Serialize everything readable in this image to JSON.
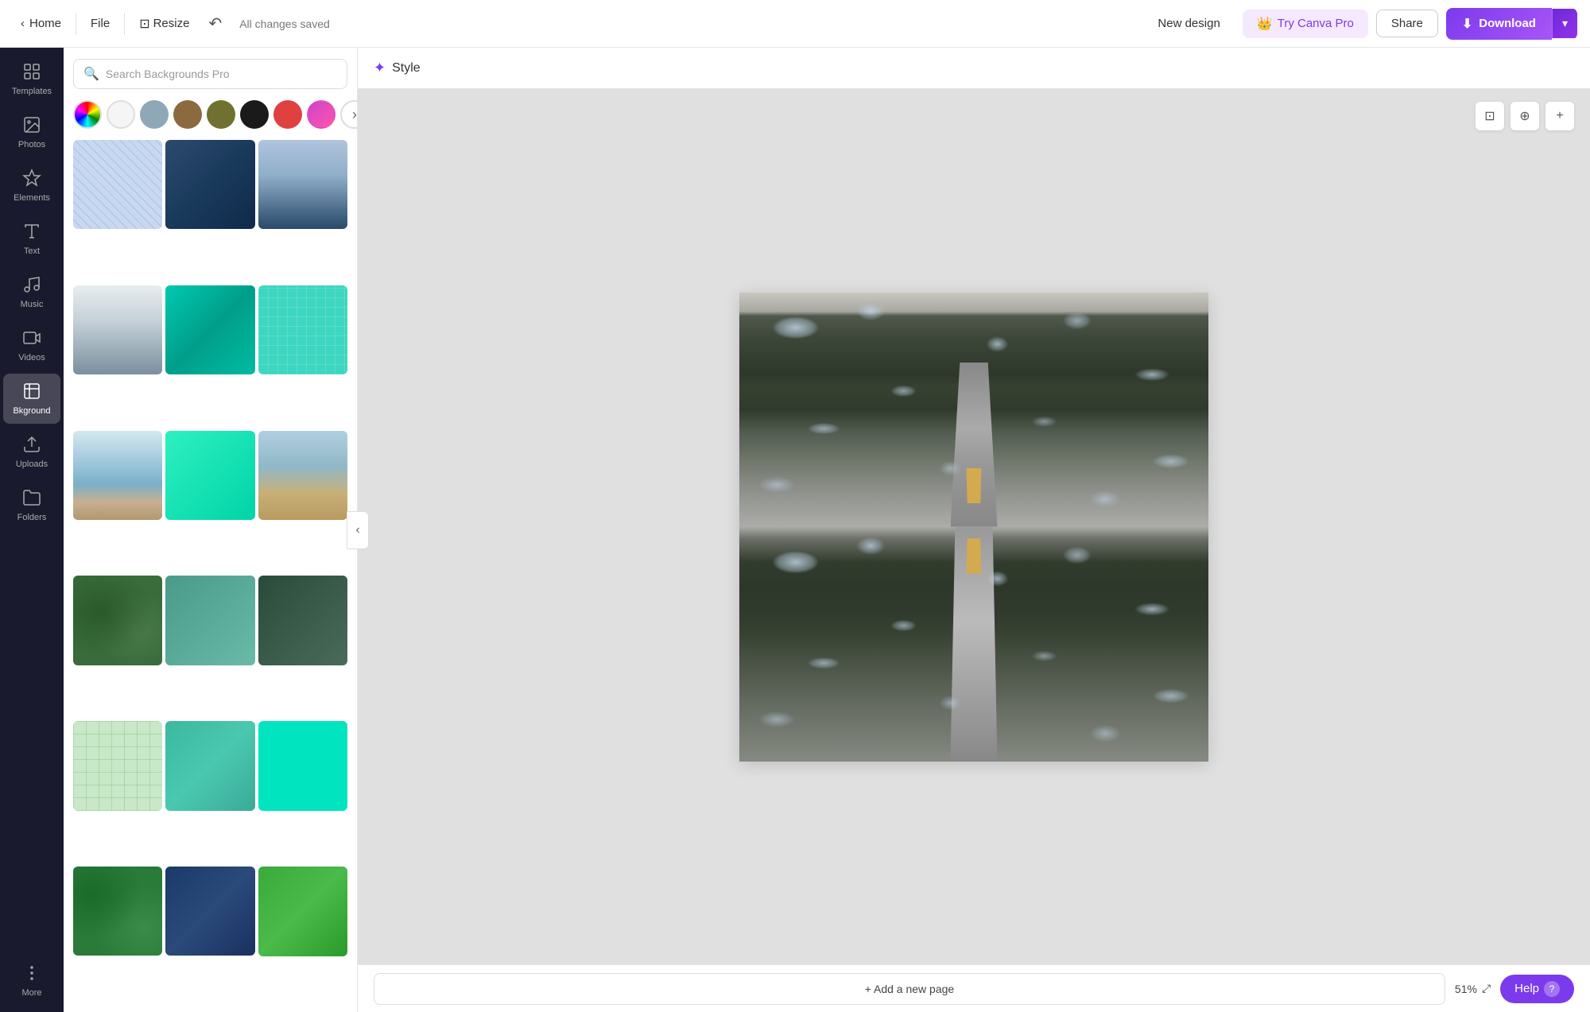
{
  "topbar": {
    "home_label": "Home",
    "file_label": "File",
    "resize_label": "Resize",
    "saved_text": "All changes saved",
    "new_design_label": "New design",
    "try_pro_label": "Try Canva Pro",
    "share_label": "Share",
    "download_label": "Download"
  },
  "sidebar": {
    "items": [
      {
        "id": "templates",
        "label": "Templates",
        "icon": "grid"
      },
      {
        "id": "photos",
        "label": "Photos",
        "icon": "image"
      },
      {
        "id": "elements",
        "label": "Elements",
        "icon": "shapes"
      },
      {
        "id": "text",
        "label": "Text",
        "icon": "text"
      },
      {
        "id": "music",
        "label": "Music",
        "icon": "music"
      },
      {
        "id": "videos",
        "label": "Videos",
        "icon": "video"
      },
      {
        "id": "background",
        "label": "Bkground",
        "icon": "background",
        "active": true
      },
      {
        "id": "uploads",
        "label": "Uploads",
        "icon": "upload"
      },
      {
        "id": "folders",
        "label": "Folders",
        "icon": "folder"
      },
      {
        "id": "more",
        "label": "More",
        "icon": "more"
      }
    ]
  },
  "left_panel": {
    "search_placeholder": "Search Backgrounds Pro",
    "colors": [
      {
        "type": "palette",
        "value": "multicolor"
      },
      {
        "value": "#f5f5f5"
      },
      {
        "value": "#8fa8b8"
      },
      {
        "value": "#8b6a40"
      },
      {
        "value": "#707030"
      },
      {
        "value": "#1a1a1a"
      },
      {
        "value": "#e04040"
      },
      {
        "value": "#cc44cc"
      }
    ],
    "more_colors_label": "›"
  },
  "style_bar": {
    "label": "Style"
  },
  "canvas": {
    "zoom": "51%"
  },
  "bottom_bar": {
    "add_page_label": "+ Add a new page",
    "help_label": "Help",
    "help_icon": "?"
  }
}
